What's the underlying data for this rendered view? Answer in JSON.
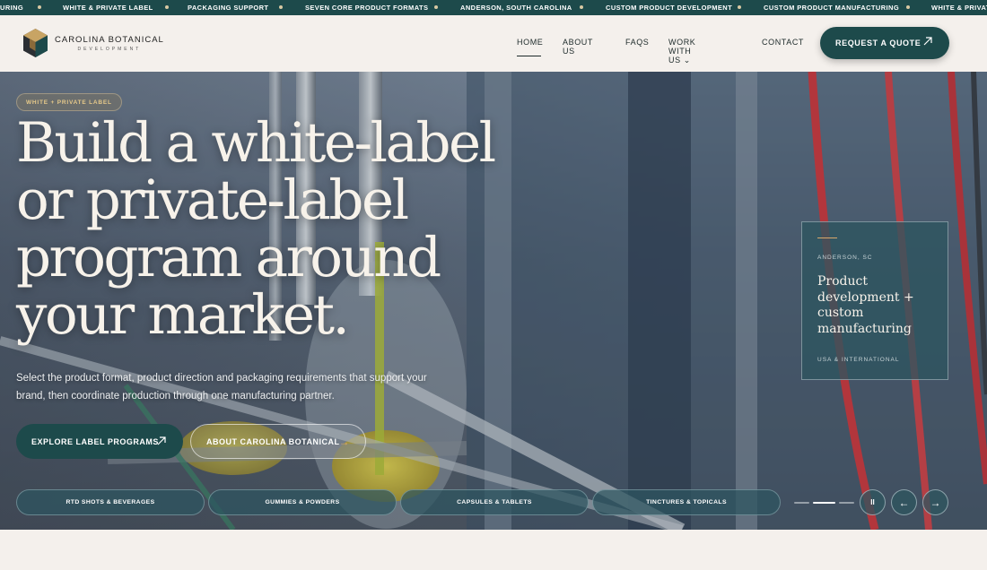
{
  "ticker": {
    "items": [
      "URING",
      "WHITE & PRIVATE LABEL",
      "PACKAGING SUPPORT",
      "SEVEN CORE PRODUCT FORMATS",
      "ANDERSON, SOUTH CAROLINA",
      "CUSTOM PRODUCT DEVELOPMENT",
      "CUSTOM PRODUCT MANUFACTURING",
      "WHITE & PRIVAT"
    ]
  },
  "logo": {
    "name": "CAROLINA BOTANICAL",
    "sub": "DEVELOPMENT"
  },
  "nav": {
    "items": [
      {
        "label": "HOME"
      },
      {
        "label": "ABOUT US"
      },
      {
        "label": "FAQS"
      },
      {
        "label": "WORK WITH US ⌄"
      },
      {
        "label": "CONTACT"
      }
    ],
    "quote_label": "REQUEST A QUOTE"
  },
  "hero": {
    "eyebrow": "WHITE + PRIVATE LABEL",
    "headline": "Build a white-label or private-label program around your market.",
    "subtext": "Select the product format, product direction and packaging requirements that support your brand, then coordinate production through one manufacturing partner.",
    "primary_cta": "EXPLORE LABEL PROGRAMS",
    "secondary_cta": "ABOUT CAROLINA BOTANICAL",
    "secondary_arrow": "→"
  },
  "card": {
    "location": "ANDERSON, SC",
    "title": "Product development + custom manufacturing",
    "footer": "USA & INTERNATIONAL"
  },
  "categories": [
    "RTD SHOTS & BEVERAGES",
    "GUMMIES & POWDERS",
    "CAPSULES & TABLETS",
    "TINCTURES & TOPICALS"
  ],
  "controls": {
    "pause": "II",
    "prev": "←",
    "next": "→"
  },
  "colors": {
    "brand": "#1d4a4b",
    "accent": "#d9a86a",
    "background": "#f4f0ec"
  }
}
